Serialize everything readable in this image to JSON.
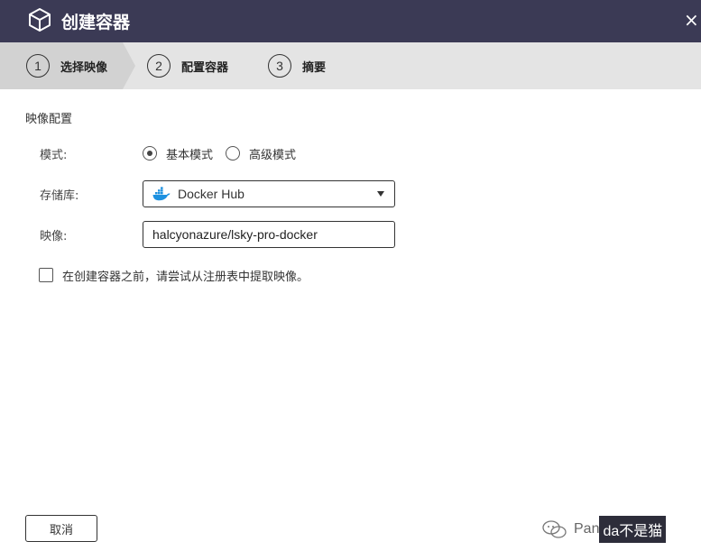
{
  "dialog": {
    "title": "创建容器",
    "close_glyph": "×"
  },
  "steps": [
    {
      "number": "1",
      "label": "选择映像",
      "state": "active"
    },
    {
      "number": "2",
      "label": "配置容器",
      "state": "pending"
    },
    {
      "number": "3",
      "label": "摘要",
      "state": "pending"
    }
  ],
  "form": {
    "section_title": "映像配置",
    "mode": {
      "label": "模式:",
      "options": [
        {
          "label": "基本模式",
          "selected": true
        },
        {
          "label": "高级模式",
          "selected": false
        }
      ]
    },
    "registry": {
      "label": "存储库:",
      "value": "Docker Hub",
      "icon": "docker-whale-icon"
    },
    "image": {
      "label": "映像:",
      "value": "halcyonazure/lsky-pro-docker"
    },
    "pull_first": {
      "label": "在创建容器之前，请尝试从注册表中提取映像。",
      "checked": false
    }
  },
  "footer": {
    "cancel_label": "取消"
  },
  "watermark": {
    "text_plain": "Pan",
    "text_box": "da不是猫"
  },
  "colors": {
    "titlebar": "#3b3a55",
    "stepbar": "#e4e4e4",
    "docker_blue": "#1d91e0"
  }
}
